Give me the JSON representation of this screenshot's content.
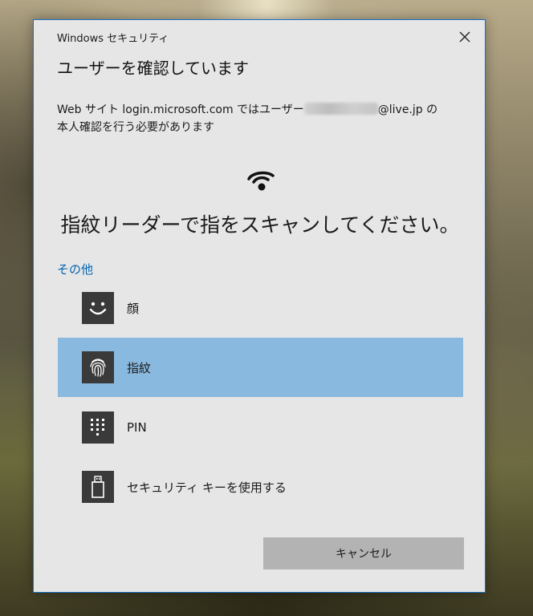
{
  "dialog": {
    "app_title": "Windows セキュリティ",
    "heading": "ユーザーを確認しています",
    "description": {
      "prefix": "Web サイト login.microsoft.com ではユーザー",
      "suffix": "@live.jp の",
      "line2": "本人確認を行う必要があります"
    },
    "prompt": "指紋リーダーで指をスキャンしてください。",
    "other_link": "その他",
    "options": [
      {
        "label": "顔",
        "icon": "face-icon",
        "selected": false
      },
      {
        "label": "指紋",
        "icon": "fingerprint-icon",
        "selected": true
      },
      {
        "label": "PIN",
        "icon": "pin-keypad-icon",
        "selected": false
      },
      {
        "label": "セキュリティ キーを使用する",
        "icon": "usb-key-icon",
        "selected": false
      }
    ],
    "cancel_label": "キャンセル"
  },
  "colors": {
    "dialog_bg": "#e6e6e6",
    "border_accent": "#1b6ec2",
    "link": "#0063b1",
    "selected_bg": "#8ab9df",
    "icon_tile": "#3a3a3a",
    "button_bg": "#b3b3b3"
  }
}
